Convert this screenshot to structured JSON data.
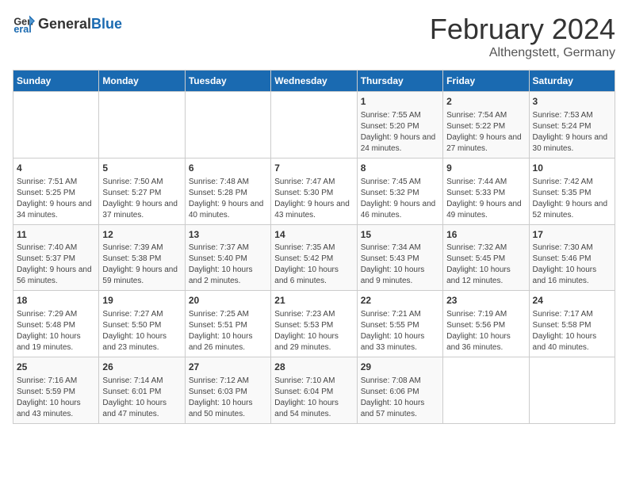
{
  "header": {
    "logo_general": "General",
    "logo_blue": "Blue",
    "title": "February 2024",
    "subtitle": "Althengstett, Germany"
  },
  "calendar": {
    "days_of_week": [
      "Sunday",
      "Monday",
      "Tuesday",
      "Wednesday",
      "Thursday",
      "Friday",
      "Saturday"
    ],
    "weeks": [
      [
        {
          "day": "",
          "info": ""
        },
        {
          "day": "",
          "info": ""
        },
        {
          "day": "",
          "info": ""
        },
        {
          "day": "",
          "info": ""
        },
        {
          "day": "1",
          "info": "Sunrise: 7:55 AM\nSunset: 5:20 PM\nDaylight: 9 hours and 24 minutes."
        },
        {
          "day": "2",
          "info": "Sunrise: 7:54 AM\nSunset: 5:22 PM\nDaylight: 9 hours and 27 minutes."
        },
        {
          "day": "3",
          "info": "Sunrise: 7:53 AM\nSunset: 5:24 PM\nDaylight: 9 hours and 30 minutes."
        }
      ],
      [
        {
          "day": "4",
          "info": "Sunrise: 7:51 AM\nSunset: 5:25 PM\nDaylight: 9 hours and 34 minutes."
        },
        {
          "day": "5",
          "info": "Sunrise: 7:50 AM\nSunset: 5:27 PM\nDaylight: 9 hours and 37 minutes."
        },
        {
          "day": "6",
          "info": "Sunrise: 7:48 AM\nSunset: 5:28 PM\nDaylight: 9 hours and 40 minutes."
        },
        {
          "day": "7",
          "info": "Sunrise: 7:47 AM\nSunset: 5:30 PM\nDaylight: 9 hours and 43 minutes."
        },
        {
          "day": "8",
          "info": "Sunrise: 7:45 AM\nSunset: 5:32 PM\nDaylight: 9 hours and 46 minutes."
        },
        {
          "day": "9",
          "info": "Sunrise: 7:44 AM\nSunset: 5:33 PM\nDaylight: 9 hours and 49 minutes."
        },
        {
          "day": "10",
          "info": "Sunrise: 7:42 AM\nSunset: 5:35 PM\nDaylight: 9 hours and 52 minutes."
        }
      ],
      [
        {
          "day": "11",
          "info": "Sunrise: 7:40 AM\nSunset: 5:37 PM\nDaylight: 9 hours and 56 minutes."
        },
        {
          "day": "12",
          "info": "Sunrise: 7:39 AM\nSunset: 5:38 PM\nDaylight: 9 hours and 59 minutes."
        },
        {
          "day": "13",
          "info": "Sunrise: 7:37 AM\nSunset: 5:40 PM\nDaylight: 10 hours and 2 minutes."
        },
        {
          "day": "14",
          "info": "Sunrise: 7:35 AM\nSunset: 5:42 PM\nDaylight: 10 hours and 6 minutes."
        },
        {
          "day": "15",
          "info": "Sunrise: 7:34 AM\nSunset: 5:43 PM\nDaylight: 10 hours and 9 minutes."
        },
        {
          "day": "16",
          "info": "Sunrise: 7:32 AM\nSunset: 5:45 PM\nDaylight: 10 hours and 12 minutes."
        },
        {
          "day": "17",
          "info": "Sunrise: 7:30 AM\nSunset: 5:46 PM\nDaylight: 10 hours and 16 minutes."
        }
      ],
      [
        {
          "day": "18",
          "info": "Sunrise: 7:29 AM\nSunset: 5:48 PM\nDaylight: 10 hours and 19 minutes."
        },
        {
          "day": "19",
          "info": "Sunrise: 7:27 AM\nSunset: 5:50 PM\nDaylight: 10 hours and 23 minutes."
        },
        {
          "day": "20",
          "info": "Sunrise: 7:25 AM\nSunset: 5:51 PM\nDaylight: 10 hours and 26 minutes."
        },
        {
          "day": "21",
          "info": "Sunrise: 7:23 AM\nSunset: 5:53 PM\nDaylight: 10 hours and 29 minutes."
        },
        {
          "day": "22",
          "info": "Sunrise: 7:21 AM\nSunset: 5:55 PM\nDaylight: 10 hours and 33 minutes."
        },
        {
          "day": "23",
          "info": "Sunrise: 7:19 AM\nSunset: 5:56 PM\nDaylight: 10 hours and 36 minutes."
        },
        {
          "day": "24",
          "info": "Sunrise: 7:17 AM\nSunset: 5:58 PM\nDaylight: 10 hours and 40 minutes."
        }
      ],
      [
        {
          "day": "25",
          "info": "Sunrise: 7:16 AM\nSunset: 5:59 PM\nDaylight: 10 hours and 43 minutes."
        },
        {
          "day": "26",
          "info": "Sunrise: 7:14 AM\nSunset: 6:01 PM\nDaylight: 10 hours and 47 minutes."
        },
        {
          "day": "27",
          "info": "Sunrise: 7:12 AM\nSunset: 6:03 PM\nDaylight: 10 hours and 50 minutes."
        },
        {
          "day": "28",
          "info": "Sunrise: 7:10 AM\nSunset: 6:04 PM\nDaylight: 10 hours and 54 minutes."
        },
        {
          "day": "29",
          "info": "Sunrise: 7:08 AM\nSunset: 6:06 PM\nDaylight: 10 hours and 57 minutes."
        },
        {
          "day": "",
          "info": ""
        },
        {
          "day": "",
          "info": ""
        }
      ]
    ]
  }
}
